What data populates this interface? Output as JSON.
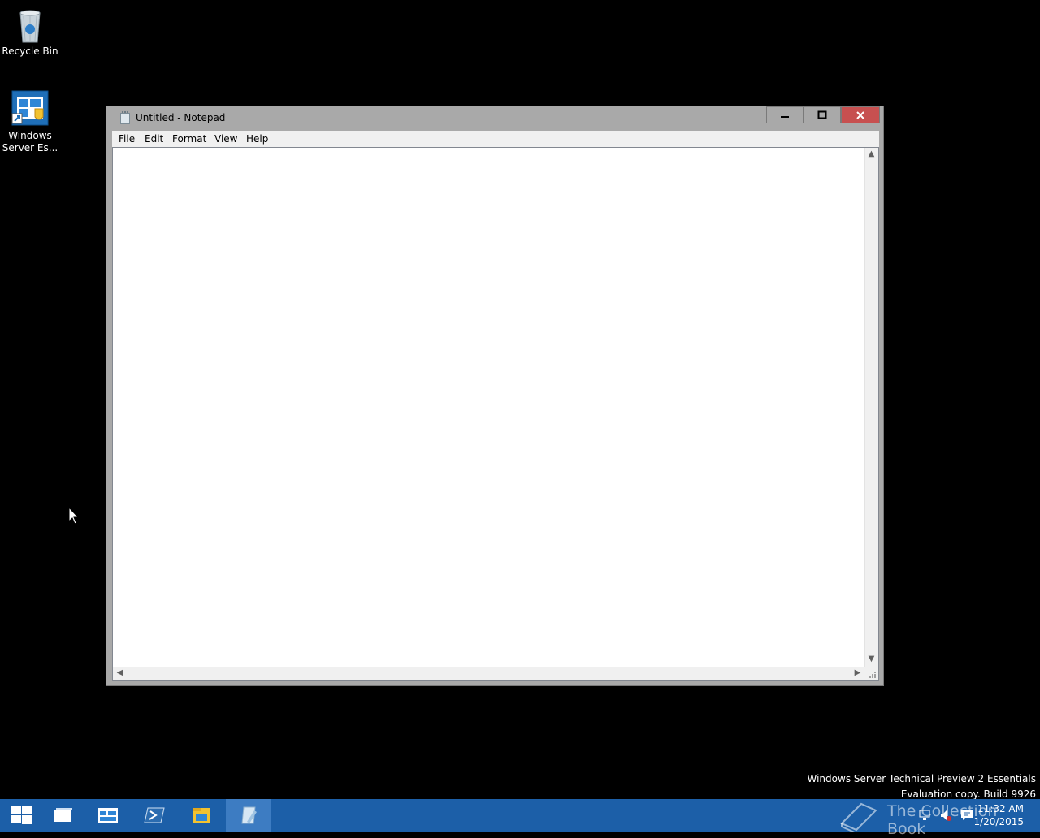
{
  "desktop": {
    "icons": [
      {
        "label": "Recycle Bin",
        "icon": "recycle-bin-icon"
      },
      {
        "label": "Windows Server Es...",
        "label_lines": [
          "Windows",
          "Server Es..."
        ],
        "icon": "windows-server-essentials-icon"
      }
    ]
  },
  "window": {
    "title": "Untitled - Notepad",
    "controls": {
      "minimize": "minimize-icon",
      "maximize": "maximize-icon",
      "close": "close-icon"
    },
    "menu": [
      "File",
      "Edit",
      "Format",
      "View",
      "Help"
    ],
    "content": ""
  },
  "watermark": {
    "line1": "Windows Server Technical Preview 2 Essentials",
    "line2": "Evaluation copy. Build 9926"
  },
  "taskbar": {
    "buttons": [
      "start-icon",
      "task-view-icon",
      "server-manager-icon",
      "powershell-icon",
      "file-explorer-icon",
      "notepad-icon"
    ],
    "active": "notepad-icon",
    "brand_text": "The Collection Book",
    "clock": {
      "time": "11:32 AM",
      "date": "1/20/2015"
    }
  },
  "colors": {
    "taskbar": "#1c5fa8",
    "window_frame": "#a9a9a9",
    "close_button": "#c75050"
  }
}
